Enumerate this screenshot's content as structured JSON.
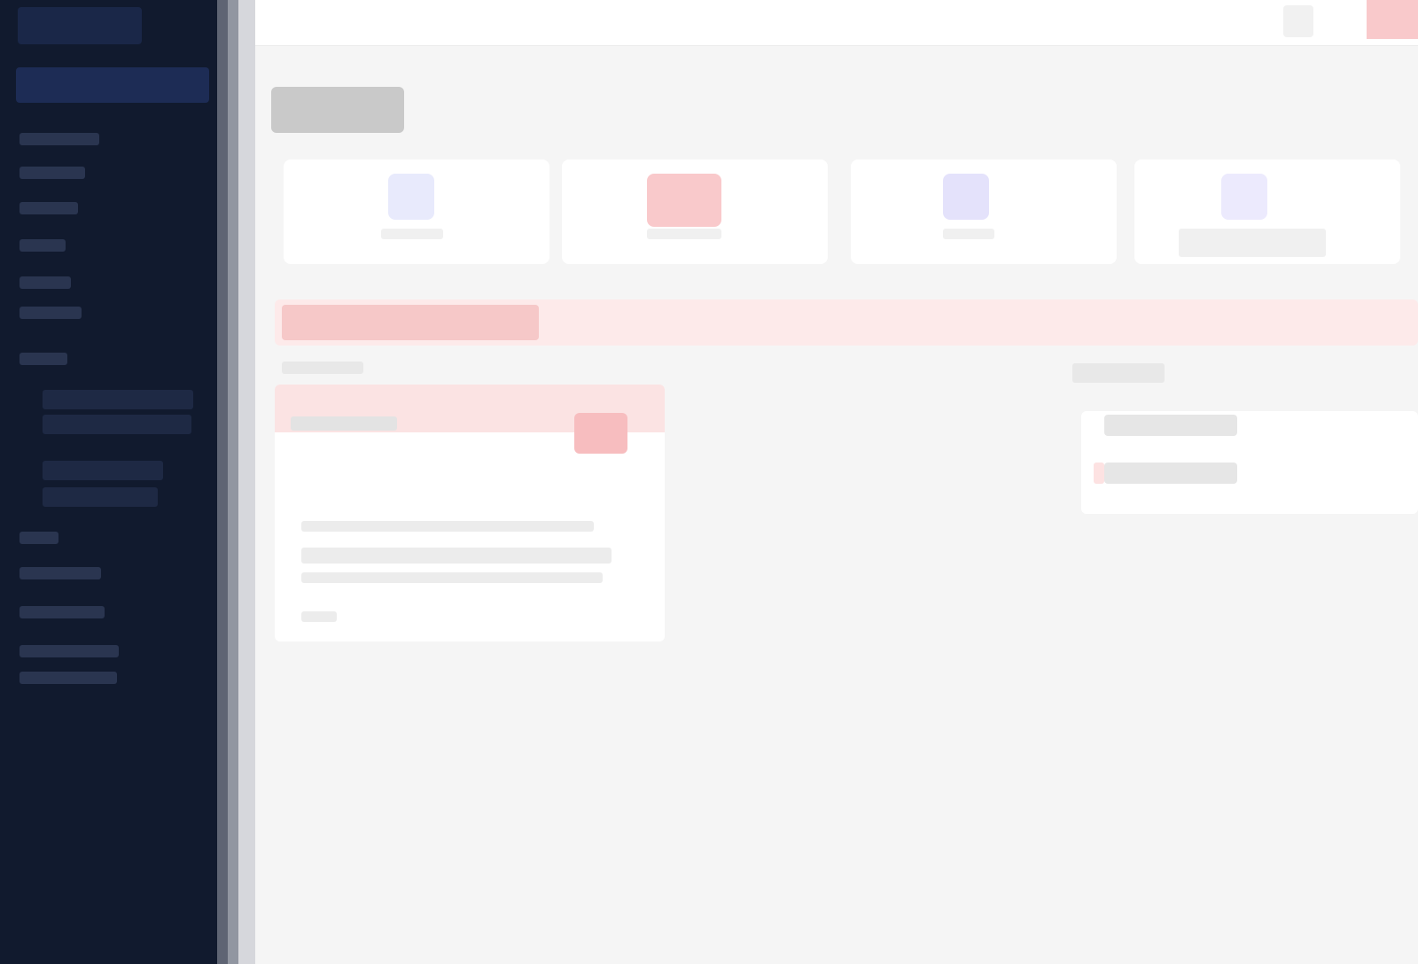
{
  "colors": {
    "sidebar_bg": "#111a2e",
    "sidebar_active": "#1d2c55",
    "main_bg": "#f5f5f5",
    "alert_bg": "#fdeaea",
    "alert_accent": "#f7bdbf",
    "stat_icon_blue": "#e8eafc",
    "stat_icon_red": "#f9c9cb",
    "stat_icon_violet": "#e4e2fb",
    "stat_icon_lavender": "#eceafd"
  },
  "sidebar": {
    "icons": [
      "logo",
      "nav-item",
      "nav-item",
      "nav-item",
      "nav-item",
      "nav-item",
      "nav-item",
      "nav-item",
      "nav-subitem",
      "nav-subitem",
      "nav-item",
      "nav-item",
      "nav-item",
      "nav-item"
    ]
  },
  "topbar": {
    "icons": [
      "user-icon",
      "alert-icon"
    ]
  },
  "stats": {
    "cards": [
      {
        "icon": "stat-icon-blue"
      },
      {
        "icon": "stat-icon-red"
      },
      {
        "icon": "stat-icon-violet"
      },
      {
        "icon": "stat-icon-lavender"
      }
    ]
  }
}
